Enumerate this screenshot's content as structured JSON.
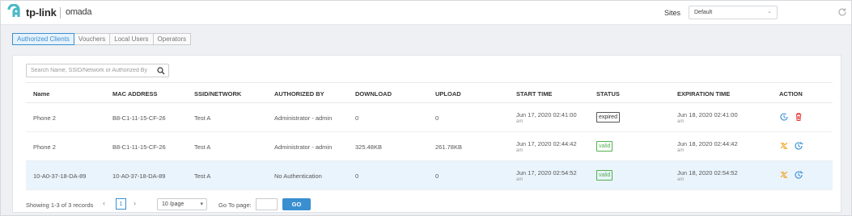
{
  "header": {
    "brand": "tp-link",
    "product": "omada",
    "site_label": "Sites",
    "site_value": "Default",
    "colors": {
      "brand_teal": "#4bb9c6",
      "accent": "#3a8fd1"
    }
  },
  "tabs": [
    {
      "label": "Authorized Clients",
      "active": true
    },
    {
      "label": "Vouchers",
      "active": false
    },
    {
      "label": "Local Users",
      "active": false
    },
    {
      "label": "Operators",
      "active": false
    }
  ],
  "search": {
    "placeholder": "Search Name, SSID/Network or Authorized By"
  },
  "table": {
    "headers": [
      "Name",
      "MAC ADDRESS",
      "SSID/NETWORK",
      "AUTHORIZED BY",
      "DOWNLOAD",
      "UPLOAD",
      "START TIME",
      "STATUS",
      "EXPIRATION TIME",
      "ACTION"
    ],
    "rows": [
      {
        "name": "Phone 2",
        "mac": "B8-C1-11-15-CF-26",
        "ssid": "Test A",
        "authorized_by": "Administrator - admin",
        "download": "0",
        "upload": "0",
        "start": "Jun 17, 2020 02:41:00",
        "start_ampm": "am",
        "status": "expired",
        "expiration": "Jun 18, 2020 02:41:00",
        "expiration_ampm": "am",
        "actions": [
          "refresh-icon",
          "delete-icon"
        ]
      },
      {
        "name": "Phone 2",
        "mac": "B8-C1-11-15-CF-26",
        "ssid": "Test A",
        "authorized_by": "Administrator - admin",
        "download": "325.48KB",
        "upload": "261.78KB",
        "start": "Jun 17, 2020 02:44:42",
        "start_ampm": "am",
        "status": "valid",
        "expiration": "Jun 18, 2020 02:44:42",
        "expiration_ampm": "am",
        "actions": [
          "unauthorize-icon",
          "extend-icon"
        ]
      },
      {
        "name": "10-A0-37-18-DA-89",
        "mac": "10-A0-37-18-DA-89",
        "ssid": "Test A",
        "authorized_by": "No Authentication",
        "download": "0",
        "upload": "0",
        "start": "Jun 17, 2020 02:54:52",
        "start_ampm": "am",
        "status": "valid",
        "expiration": "Jun 18, 2020 02:54:52",
        "expiration_ampm": "am",
        "actions": [
          "unauthorize-icon",
          "extend-icon"
        ],
        "highlighted": true
      }
    ]
  },
  "footer": {
    "summary": "Showing 1-3 of 3 records",
    "prev": "‹",
    "current_page": "1",
    "next": "›",
    "page_size": "10 /page",
    "goto_label": "Go To page:",
    "go": "GO"
  }
}
